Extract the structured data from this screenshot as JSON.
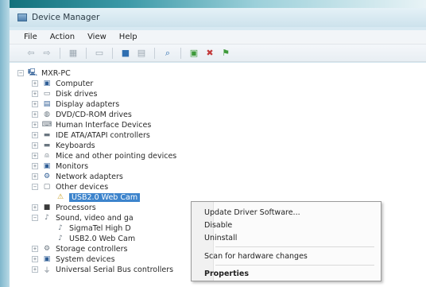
{
  "window": {
    "title": "Device Manager"
  },
  "menu": [
    "File",
    "Action",
    "View",
    "Help"
  ],
  "toolbar": {
    "icons": [
      "back-arrow-icon",
      "forward-arrow-icon",
      "properties-grid-icon",
      "console-tree-icon",
      "help-icon",
      "show-hidden-icon",
      "scan-hardware-icon",
      "update-driver-icon",
      "disable-device-icon",
      "uninstall-device-icon"
    ]
  },
  "tree": {
    "root": "MXR-PC",
    "items": [
      {
        "label": "Computer",
        "icon": "computer-icon"
      },
      {
        "label": "Disk drives",
        "icon": "disk-drive-icon"
      },
      {
        "label": "Display adapters",
        "icon": "display-adapter-icon"
      },
      {
        "label": "DVD/CD-ROM drives",
        "icon": "dvd-drive-icon"
      },
      {
        "label": "Human Interface Devices",
        "icon": "hid-icon"
      },
      {
        "label": "IDE ATA/ATAPI controllers",
        "icon": "ide-controller-icon"
      },
      {
        "label": "Keyboards",
        "icon": "keyboard-icon"
      },
      {
        "label": "Mice and other pointing devices",
        "icon": "mouse-icon"
      },
      {
        "label": "Monitors",
        "icon": "monitor-icon"
      },
      {
        "label": "Network adapters",
        "icon": "network-adapter-icon"
      },
      {
        "label": "Other devices",
        "icon": "other-devices-icon"
      }
    ],
    "other_child": "USB2.0 Web Cam",
    "after": [
      {
        "label": "Processors",
        "icon": "processor-icon"
      },
      {
        "label": "Sound, video and ga",
        "icon": "sound-icon"
      }
    ],
    "sound_children": [
      "SigmaTel High D",
      "USB2.0 Web Cam"
    ],
    "tail": [
      {
        "label": "Storage controllers",
        "icon": "storage-controller-icon"
      },
      {
        "label": "System devices",
        "icon": "system-devices-icon"
      },
      {
        "label": "Universal Serial Bus controllers",
        "icon": "usb-controller-icon"
      }
    ]
  },
  "context_menu": {
    "update": "Update Driver Software...",
    "disable": "Disable",
    "uninstall": "Uninstall",
    "scan": "Scan for hardware changes",
    "properties": "Properties"
  },
  "colors": {
    "selection": "#3d84cc",
    "frame_accent": "#0f6e78"
  }
}
